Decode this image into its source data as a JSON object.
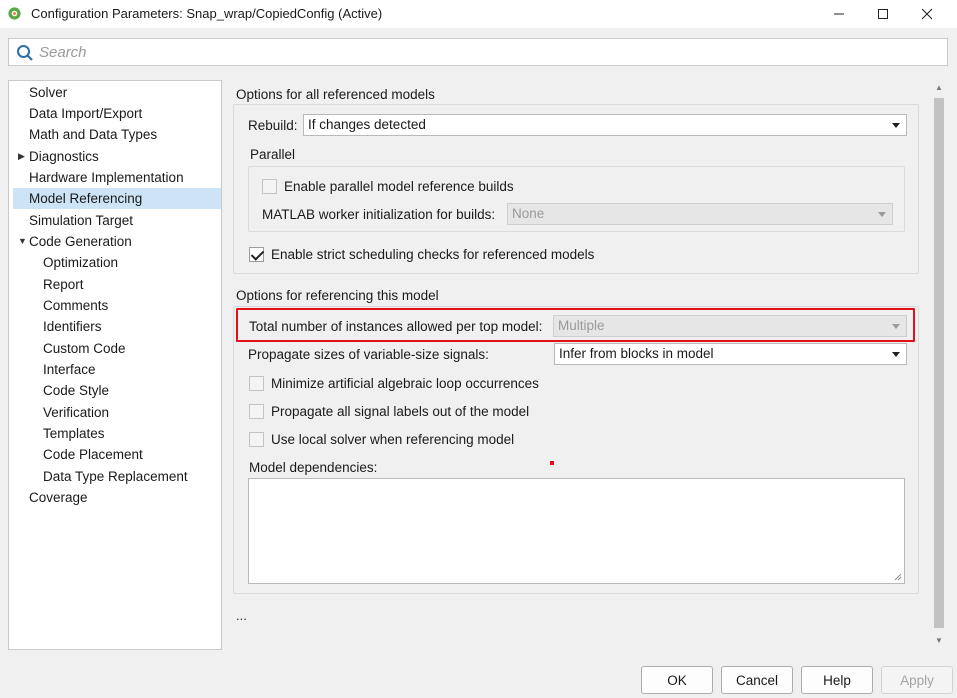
{
  "window": {
    "title": "Configuration Parameters: Snap_wrap/CopiedConfig (Active)",
    "icon": "matlab-config-icon",
    "controls": [
      "minimize-icon",
      "maximize-icon",
      "close-icon"
    ]
  },
  "search": {
    "placeholder": "Search",
    "value": ""
  },
  "tree": {
    "items": [
      {
        "label": "Solver",
        "level": 0
      },
      {
        "label": "Data Import/Export",
        "level": 0
      },
      {
        "label": "Math and Data Types",
        "level": 0
      },
      {
        "label": "Diagnostics",
        "level": 0,
        "expander": "collapsed"
      },
      {
        "label": "Hardware Implementation",
        "level": 0
      },
      {
        "label": "Model Referencing",
        "level": 0,
        "selected": true
      },
      {
        "label": "Simulation Target",
        "level": 0
      },
      {
        "label": "Code Generation",
        "level": 0,
        "expander": "expanded"
      },
      {
        "label": "Optimization",
        "level": 1
      },
      {
        "label": "Report",
        "level": 1
      },
      {
        "label": "Comments",
        "level": 1
      },
      {
        "label": "Identifiers",
        "level": 1
      },
      {
        "label": "Custom Code",
        "level": 1
      },
      {
        "label": "Interface",
        "level": 1
      },
      {
        "label": "Code Style",
        "level": 1
      },
      {
        "label": "Verification",
        "level": 1
      },
      {
        "label": "Templates",
        "level": 1
      },
      {
        "label": "Code Placement",
        "level": 1
      },
      {
        "label": "Data Type Replacement",
        "level": 1
      },
      {
        "label": "Coverage",
        "level": 0
      }
    ]
  },
  "all_models": {
    "heading": "Options for all referenced models",
    "rebuild_label": "Rebuild:",
    "rebuild_value": "If changes detected",
    "parallel": {
      "heading": "Parallel",
      "enable_label": "Enable parallel model reference builds",
      "enable_checked": false,
      "worker_label": "MATLAB worker initialization for builds:",
      "worker_value": "None"
    },
    "strict_label": "Enable strict scheduling checks for referenced models",
    "strict_checked": true
  },
  "this_model": {
    "heading": "Options for referencing this model",
    "instances_label": "Total number of instances allowed per top model:",
    "instances_value": "Multiple",
    "propagate_sizes_label": "Propagate sizes of variable-size signals:",
    "propagate_sizes_value": "Infer from blocks in model",
    "minimize_label": "Minimize artificial algebraic loop occurrences",
    "minimize_checked": false,
    "propagate_labels_label": "Propagate all signal labels out of the model",
    "propagate_labels_checked": false,
    "local_solver_label": "Use local solver when referencing model",
    "local_solver_checked": false,
    "dependencies_label": "Model dependencies:",
    "dependencies_value": ""
  },
  "ellipsis": "...",
  "buttons": {
    "ok": "OK",
    "cancel": "Cancel",
    "help": "Help",
    "apply": "Apply"
  },
  "colors": {
    "highlight": "#e0111b",
    "selection": "#cde4f7"
  }
}
